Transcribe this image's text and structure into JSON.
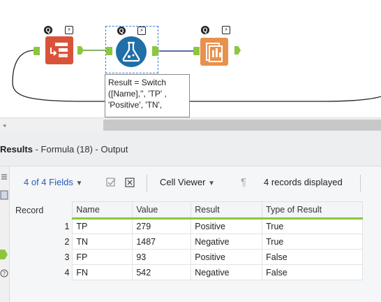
{
  "canvas": {
    "tools": [
      {
        "name": "Text Input",
        "color": "#d9533a",
        "badges": {
          "q": "Q",
          "bolt": "⚡"
        }
      },
      {
        "name": "Formula",
        "color": "#1f6fa8",
        "badges": {
          "q": "Q",
          "bolt": "⚡"
        }
      },
      {
        "name": "Browse",
        "color": "#e8914c",
        "badges": {
          "q": "Q",
          "bolt": "⚡"
        }
      }
    ],
    "annotation": "Result = Switch\n([Name],'', 'TP' ,\n'Positive', 'TN',"
  },
  "results": {
    "title_bold": "Results",
    "title_rest": " - Formula (18) - Output"
  },
  "toolbar": {
    "fields": "4 of 4 Fields",
    "cell_viewer": "Cell Viewer",
    "records_displayed": "4 records displayed"
  },
  "grid": {
    "record_header": "Record",
    "columns": [
      "Name",
      "Value",
      "Result",
      "Type of Result"
    ],
    "rows": [
      {
        "record": "1",
        "cells": [
          "TP",
          "279",
          "Positive",
          "True"
        ]
      },
      {
        "record": "2",
        "cells": [
          "TN",
          "1487",
          "Negative",
          "True"
        ]
      },
      {
        "record": "3",
        "cells": [
          "FP",
          "93",
          "Positive",
          "False"
        ]
      },
      {
        "record": "4",
        "cells": [
          "FN",
          "542",
          "Negative",
          "False"
        ]
      }
    ]
  },
  "colors": {
    "anchor_green": "#8cc63f",
    "link_blue": "#3a7bd5",
    "text_input_red": "#d9533a",
    "formula_blue": "#1f6fa8",
    "browse_orange": "#e8914c"
  }
}
